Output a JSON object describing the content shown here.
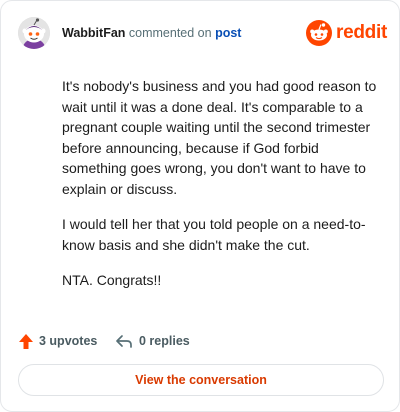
{
  "comment": {
    "author": "WabbitFan",
    "verb": "commented on",
    "target": "post",
    "paragraphs": [
      "It's nobody's business and you had good reason to wait until it was a done deal. It's comparable to a pregnant couple waiting until the second trimester before announcing, because if God forbid something goes wrong, you don't want to have to explain or discuss.",
      "I would tell her that you told people on a need-to-know basis and she didn't make the cut.",
      "NTA. Congrats!!"
    ],
    "upvotes": "3 upvotes",
    "replies": "0 replies",
    "cta": "View the conversation"
  },
  "brand": {
    "wordmark": "reddit",
    "color": "#ff4500"
  },
  "colors": {
    "upvote": "#ff4500",
    "cta": "#d93a00",
    "link": "#0a4fb5"
  },
  "icons": [
    "snoo-avatar-icon",
    "reddit-logo-icon",
    "upvote-arrow-icon",
    "reply-arrow-icon"
  ]
}
